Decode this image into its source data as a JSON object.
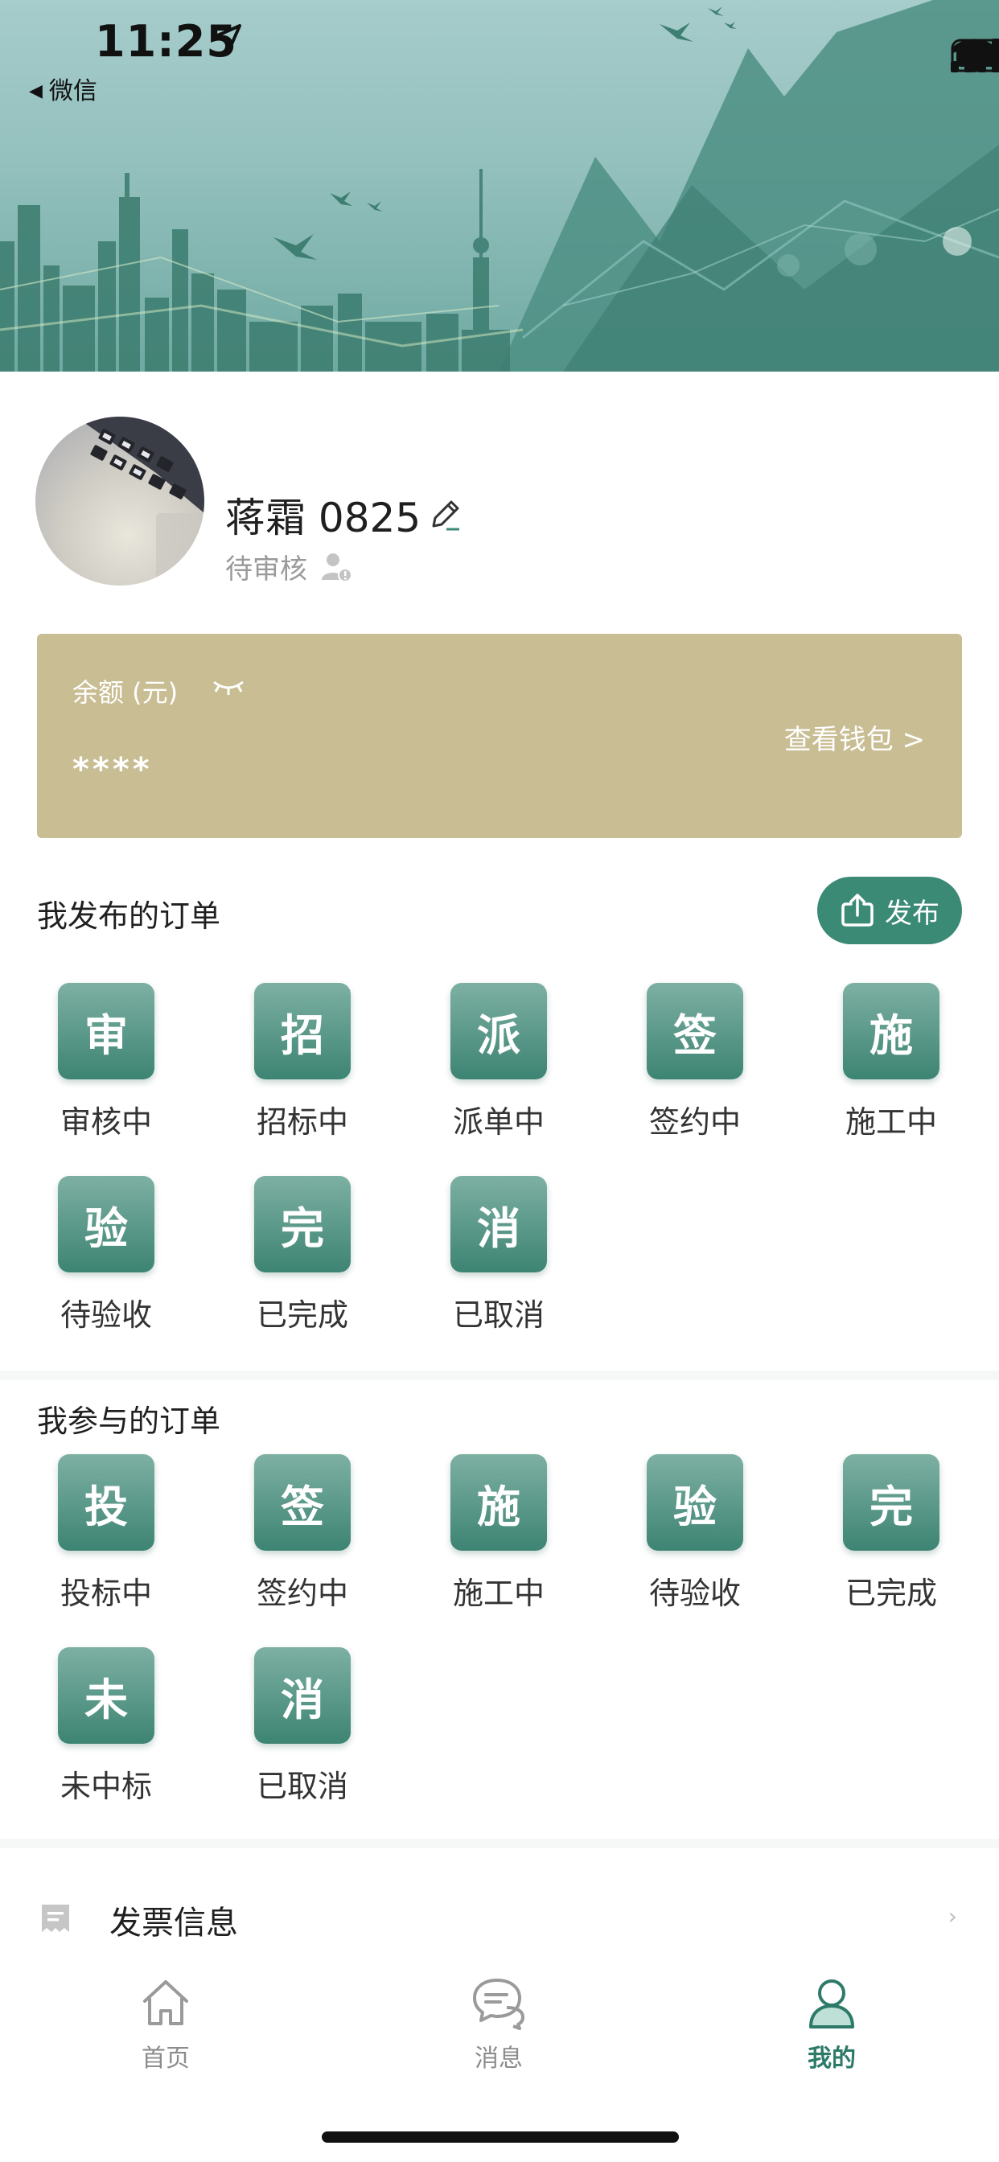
{
  "status_bar": {
    "time": "11:25",
    "back_label": "微信"
  },
  "profile": {
    "username": "蒋霜 0825",
    "status": "待审核"
  },
  "balance": {
    "label": "余额 (元)",
    "value": "****",
    "wallet_link": "查看钱包 >"
  },
  "published_orders": {
    "title": "我发布的订单",
    "publish_label": "发布",
    "items": [
      {
        "char": "审",
        "label": "审核中"
      },
      {
        "char": "招",
        "label": "招标中"
      },
      {
        "char": "派",
        "label": "派单中"
      },
      {
        "char": "签",
        "label": "签约中"
      },
      {
        "char": "施",
        "label": "施工中"
      },
      {
        "char": "验",
        "label": "待验收"
      },
      {
        "char": "完",
        "label": "已完成"
      },
      {
        "char": "消",
        "label": "已取消"
      }
    ]
  },
  "joined_orders": {
    "title": "我参与的订单",
    "items": [
      {
        "char": "投",
        "label": "投标中"
      },
      {
        "char": "签",
        "label": "签约中"
      },
      {
        "char": "施",
        "label": "施工中"
      },
      {
        "char": "验",
        "label": "待验收"
      },
      {
        "char": "完",
        "label": "已完成"
      },
      {
        "char": "未",
        "label": "未中标"
      },
      {
        "char": "消",
        "label": "已取消"
      }
    ]
  },
  "menu": {
    "invoice_label": "发票信息"
  },
  "tabbar": {
    "tabs": [
      {
        "label": "首页",
        "icon": "home-icon"
      },
      {
        "label": "消息",
        "icon": "message-icon"
      },
      {
        "label": "我的",
        "icon": "user-icon",
        "active": true
      }
    ]
  },
  "colors": {
    "accent": "#3b8a76",
    "balance_card": "#c9bd93",
    "tile_top": "#7db0a3",
    "tile_bottom": "#3d8473"
  }
}
